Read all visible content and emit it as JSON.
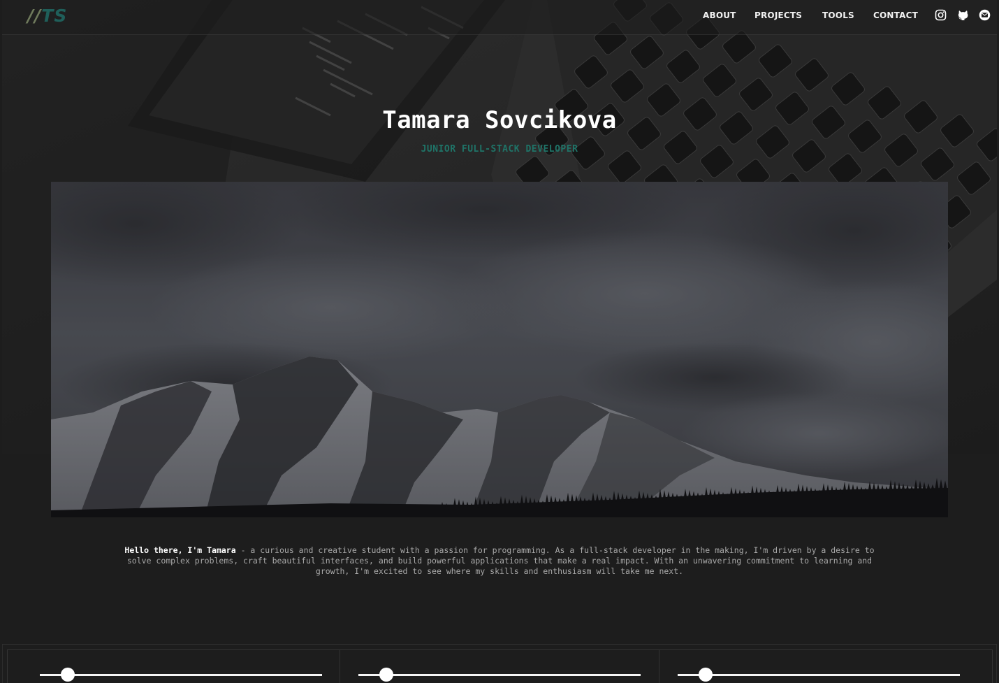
{
  "navbar": {
    "logo_slashes": "//",
    "logo_initials": "TS",
    "links": [
      "ABOUT",
      "PROJECTS",
      "TOOLS",
      "CONTACT"
    ],
    "icons": [
      "instagram-icon",
      "github-icon",
      "email-icon"
    ]
  },
  "hero": {
    "title": "Tamara Sovcikova",
    "subtitle": "JUNIOR FULL-STACK DEVELOPER"
  },
  "intro": {
    "greeting": "Hello there, I'm Tamara",
    "text": " - a curious and creative student with a passion for programming. As a full-stack developer in the making, I'm driven by a desire to solve complex problems, craft beautiful interfaces, and build powerful applications that make a real impact. With an unwavering commitment to learning and growth, I'm excited to see where my skills and enthusiasm will take me next."
  },
  "skills": {
    "sliders": [
      {
        "level": 0.1
      },
      {
        "level": 0.1
      },
      {
        "level": 0.1
      }
    ]
  },
  "colors": {
    "accent": "#1f7468",
    "background": "#1d1d1d",
    "logo_slashes": "#6f7a5c",
    "logo_initials": "#1f5f5a"
  }
}
